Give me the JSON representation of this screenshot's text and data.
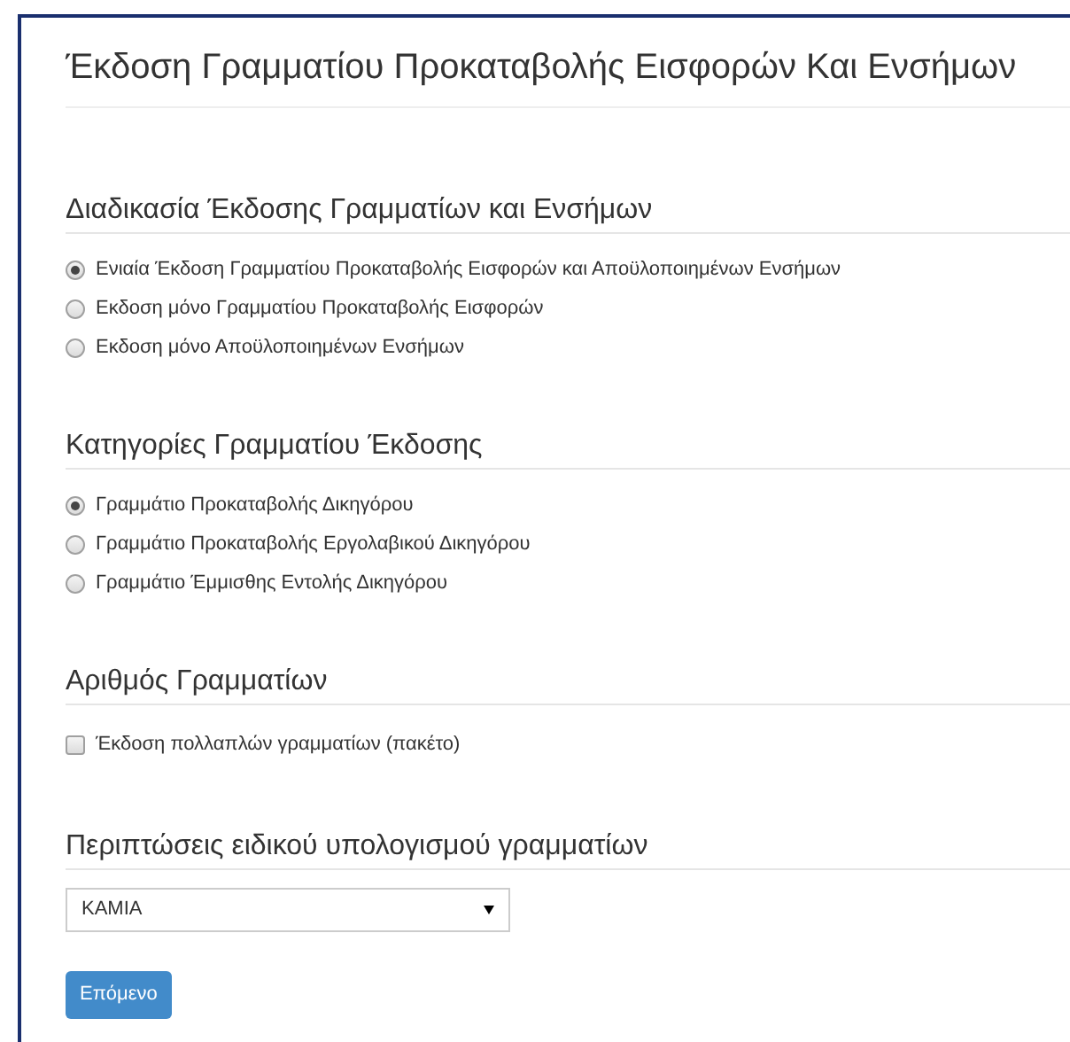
{
  "title": "Έκδοση Γραμματίου Προκαταβολής Εισφορών Και Ενσήμων",
  "sections": [
    {
      "kind": "radio",
      "heading": "Διαδικασία Έκδοσης Γραμματίων και Ενσήμων",
      "options": [
        {
          "label": "Ενιαία Έκδοση Γραμματίου Προκαταβολής Εισφορών και Απoϋλοποιημένων Ενσήμων",
          "selected": true
        },
        {
          "label": "Εκδοση μόνο Γραμματίου Προκαταβολής Εισφορών",
          "selected": false
        },
        {
          "label": "Εκδοση μόνο Απoϋλοποιημένων Ενσήμων",
          "selected": false
        }
      ]
    },
    {
      "kind": "radio",
      "heading": "Κατηγορίες Γραμματίου Έκδοσης",
      "options": [
        {
          "label": "Γραμμάτιο Προκαταβολής Δικηγόρου",
          "selected": true
        },
        {
          "label": "Γραμμάτιο Προκαταβολής Εργολαβικού Δικηγόρου",
          "selected": false
        },
        {
          "label": "Γραμμάτιο Έμμισθης Εντολής Δικηγόρου",
          "selected": false
        }
      ]
    },
    {
      "kind": "checkbox",
      "heading": "Αριθμός Γραμματίων",
      "options": [
        {
          "label": "Έκδοση πολλαπλών γραμματίων (πακέτο)",
          "checked": false
        }
      ]
    },
    {
      "kind": "select",
      "heading": "Περιπτώσεις ειδικού υπολογισμού γραμματίων",
      "value": "ΚΑΜΙΑ"
    }
  ],
  "button": "Επόμενο"
}
